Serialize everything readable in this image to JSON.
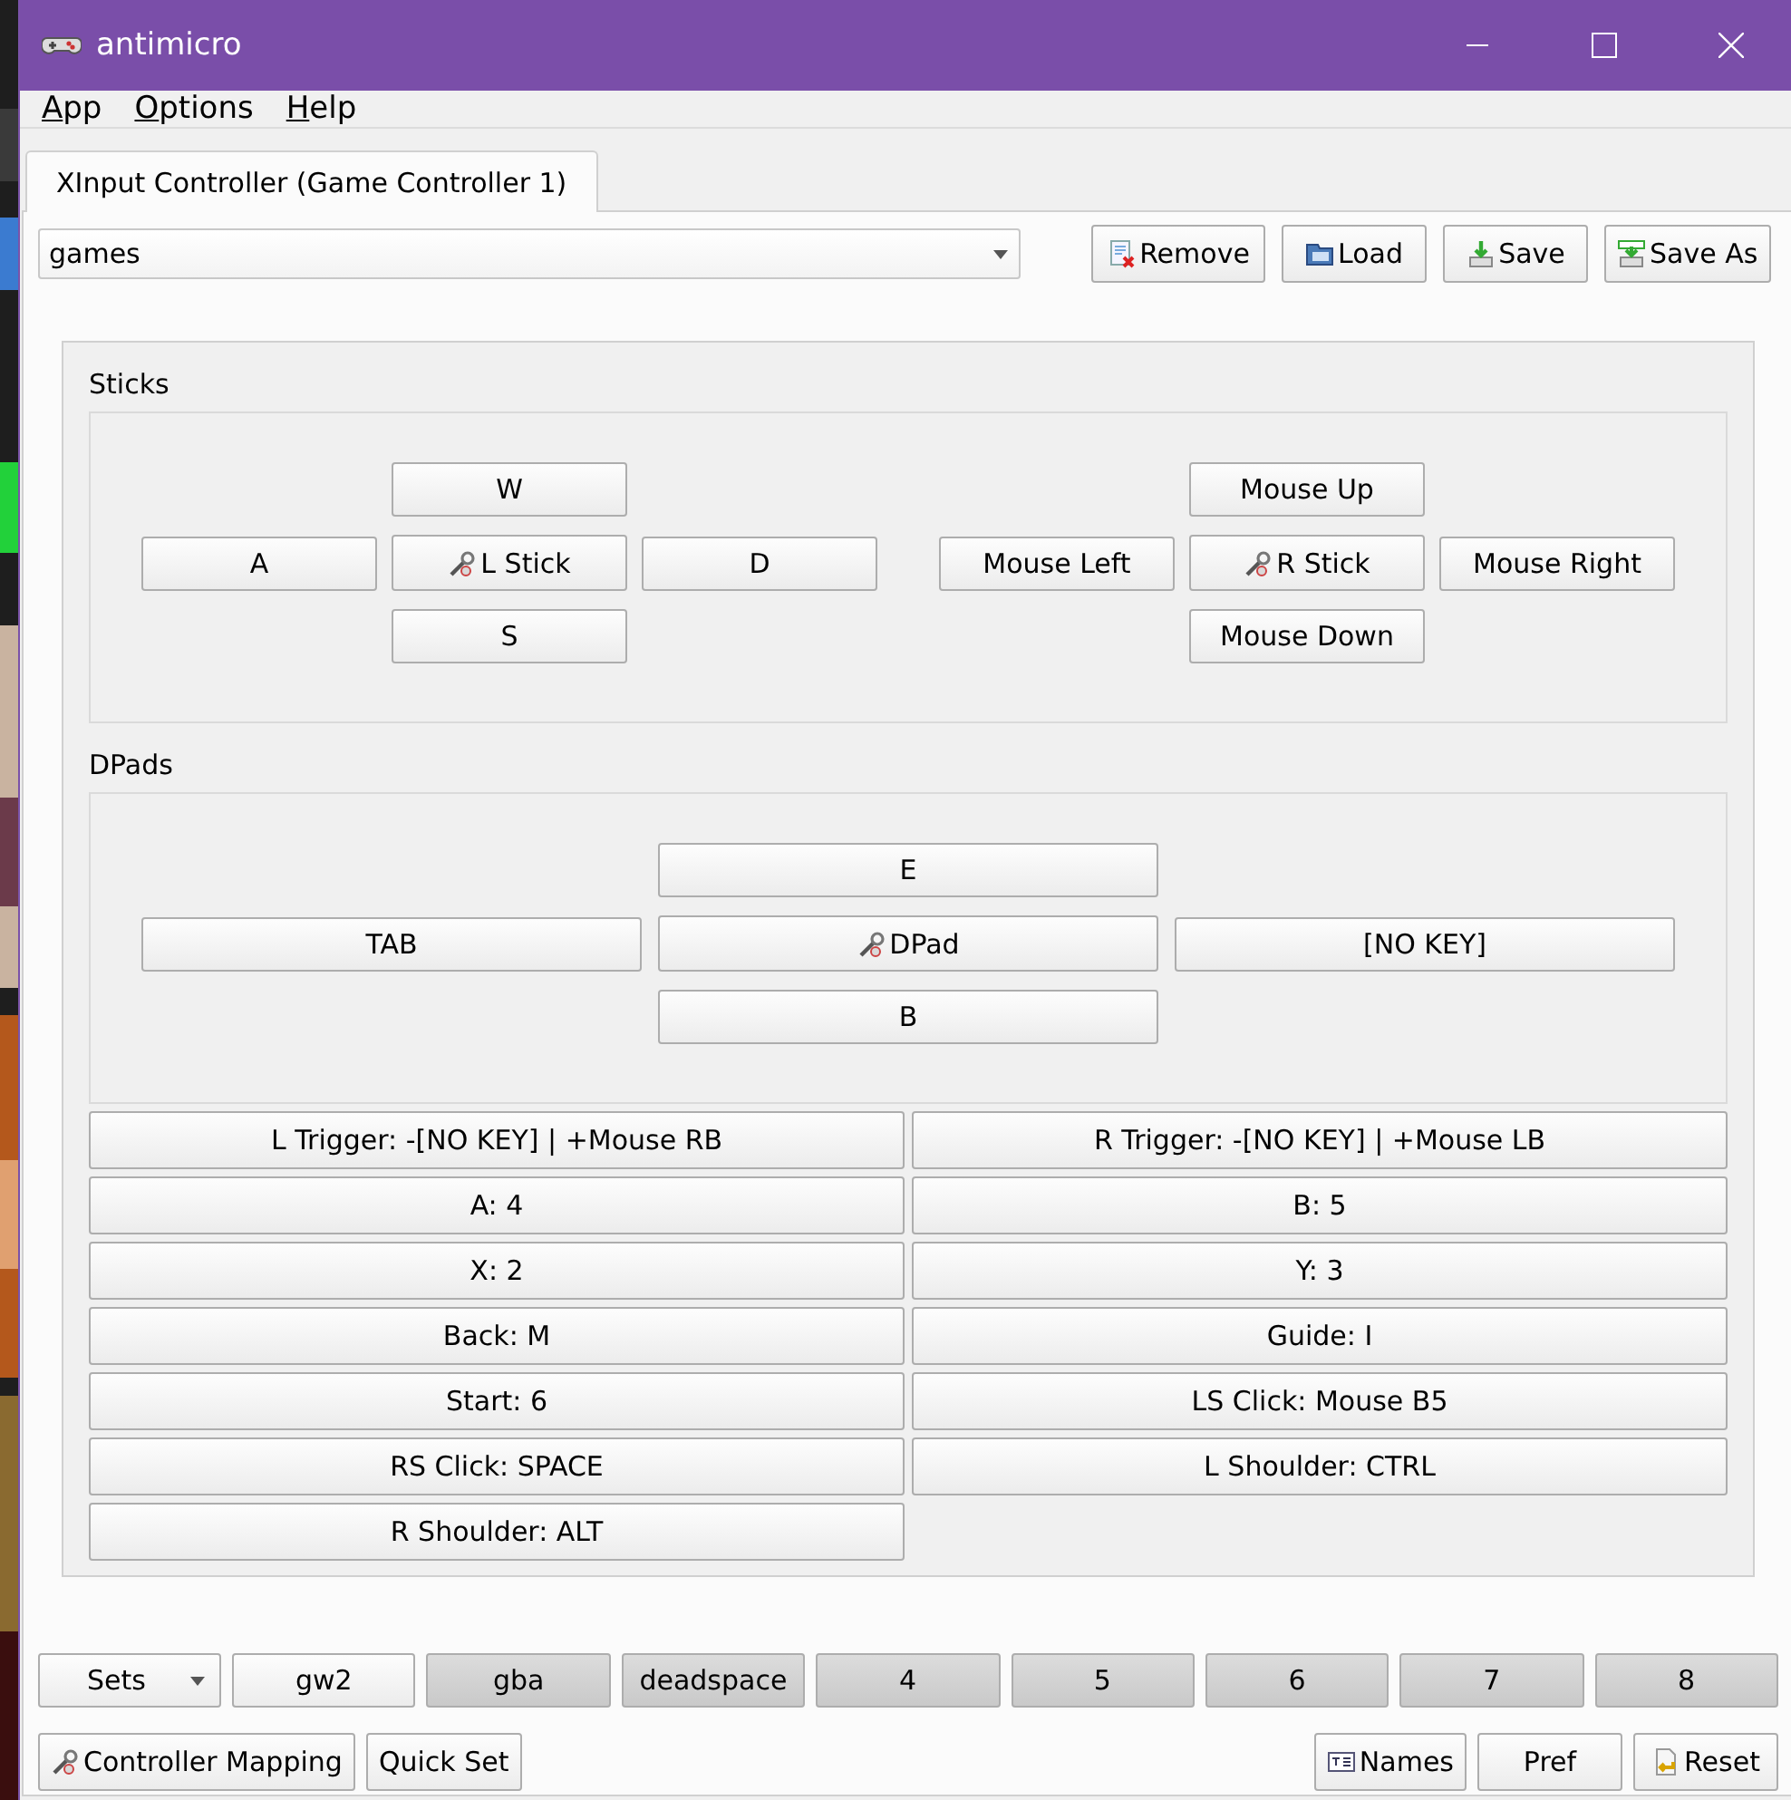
{
  "window": {
    "title": "antimicro"
  },
  "menu": [
    {
      "label": "App"
    },
    {
      "label": "Options"
    },
    {
      "label": "Help"
    }
  ],
  "tabs": [
    {
      "label": "XInput Controller (Game Controller 1)",
      "selected": true
    }
  ],
  "profile": {
    "value": "games"
  },
  "toolbar": [
    {
      "label": "Remove",
      "kind": "remove"
    },
    {
      "label": "Load",
      "kind": "load"
    },
    {
      "label": "Save",
      "kind": "save"
    },
    {
      "label": "Save As",
      "kind": "save_as"
    }
  ],
  "main": {
    "sticks_title": "Sticks",
    "sticks": [
      {
        "up": "W",
        "left": "A",
        "center": "L Stick",
        "right": "D",
        "down": "S"
      },
      {
        "up": "Mouse Up",
        "left": "Mouse Left",
        "center": "R Stick",
        "right": "Mouse Right",
        "down": "Mouse Down"
      }
    ],
    "dpads_title": "DPads",
    "dpads": [
      {
        "up": "E",
        "left": "TAB",
        "center": "DPad",
        "right": "[NO KEY]",
        "down": "B"
      }
    ],
    "buttons": [
      "L Trigger: -[NO KEY] | +Mouse RB",
      "R Trigger: -[NO KEY] | +Mouse LB",
      "A: 4",
      "B: 5",
      "X: 2",
      "Y: 3",
      "Back: M",
      "Guide: I",
      "Start: 6",
      "LS Click: Mouse B5",
      "RS Click: SPACE",
      "L Shoulder: CTRL",
      "R Shoulder: ALT"
    ]
  },
  "sets": {
    "menu_label": "Sets",
    "items": [
      {
        "label": "gw2",
        "selected": true
      },
      {
        "label": "gba",
        "selected": false
      },
      {
        "label": "deadspace",
        "selected": false
      },
      {
        "label": "4",
        "selected": false
      },
      {
        "label": "5",
        "selected": false
      },
      {
        "label": "6",
        "selected": false
      },
      {
        "label": "7",
        "selected": false
      },
      {
        "label": "8",
        "selected": false
      }
    ]
  },
  "bottom_left": [
    {
      "label": "Controller Mapping",
      "kind": "mapping"
    },
    {
      "label": "Quick Set",
      "kind": "plain"
    }
  ],
  "bottom_right": [
    {
      "label": "Names",
      "kind": "names"
    },
    {
      "label": "Pref",
      "kind": "plain"
    },
    {
      "label": "Reset",
      "kind": "reset"
    }
  ]
}
